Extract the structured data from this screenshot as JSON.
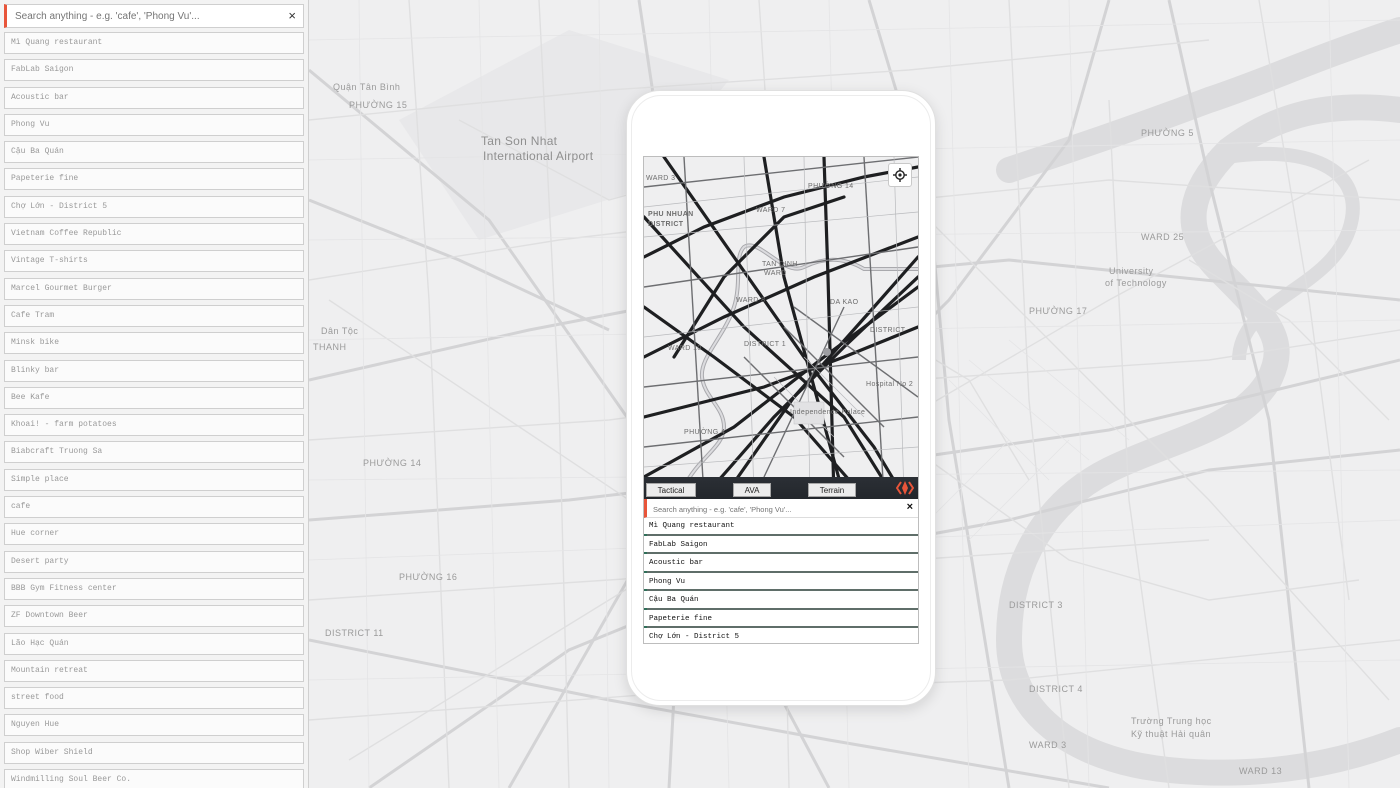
{
  "sidebar": {
    "search": {
      "placeholder": "Search anything - e.g. 'cafe', 'Phong Vu'...",
      "clear_icon": "×"
    },
    "items": [
      "Mì Quang restaurant",
      "FabLab Saigon",
      "Acoustic bar",
      "Phong Vu",
      "Cậu Ba Quán",
      "Papeterie fine",
      "Chợ Lớn - District 5",
      "Vietnam Coffee Republic",
      "Vintage T-shirts",
      "Marcel Gourmet Burger",
      "Cafe Tram",
      "Minsk bike",
      "Blinky bar",
      "Bee Kafe",
      "Khoai! - farm potatoes",
      "Biabcraft Truong Sa",
      "Simple place",
      "cafe",
      "Hue corner",
      "Desert party",
      "BBB Gym Fitness center",
      "ZF Downtown Beer",
      "Lão Hạc Quán",
      "Mountain retreat",
      "street food",
      "Nguyen Hue",
      "Shop Wiber Shield",
      "Windmilling Soul Beer Co."
    ]
  },
  "map_labels": {
    "airport": "Tan Son Nhat",
    "airport2": "International Airport",
    "tan_binh": "Quận Tân Bình",
    "phuong15": "PHƯỜNG 15",
    "dan_toc": "Dân Tộc",
    "thanh": "THANH",
    "phuong14": "PHƯỜNG 14",
    "district11": "DISTRICT 11",
    "phuong16": "PHƯỜNG 16",
    "phuong5": "PHƯỜNG 5",
    "ward25": "WARD 25",
    "uni": "University",
    "of_tech": "of Technology",
    "phuong17": "PHƯỜNG 17",
    "district4": "DISTRICT 4",
    "ward3": "WARD 3",
    "truong": "Trường Trung học",
    "ky_thuat": "Kỹ thuật Hải quân",
    "district3": "DISTRICT 3",
    "ward13": "WARD 13"
  },
  "phone_map_labels": {
    "ward3": "WARD 3",
    "phuong14": "PHƯỜNG 14",
    "ward7": "WARD 7",
    "phu_nhuan": "PHU NHUAN",
    "district": "DISTRICT",
    "tan_dinh": "TAN DINH",
    "ward": "WARD",
    "ward8": "WARD 8",
    "da_kao": "DA KAO",
    "district2": "DISTRICT",
    "ward10": "WARD 10",
    "district1": "DISTRICT 1",
    "independence": "Independence Palace",
    "hospital": "Hospital No 2",
    "phuong4": "PHƯỜNG 4"
  },
  "phone": {
    "tabs": [
      "Tactical",
      "AVA",
      "Terrain"
    ],
    "search": {
      "placeholder": "Search anything - e.g. 'cafe', 'Phong Vu'...",
      "clear_icon": "×"
    },
    "items": [
      "Mì Quang restaurant",
      "FabLab Saigon",
      "Acoustic bar",
      "Phong Vu",
      "Cậu Ba Quán",
      "Papeterie fine",
      "Chợ Lớn - District 5"
    ]
  },
  "colors": {
    "accent": "#e8553a",
    "toolbar": "#262a30",
    "list_divider": "#5f6e69"
  }
}
